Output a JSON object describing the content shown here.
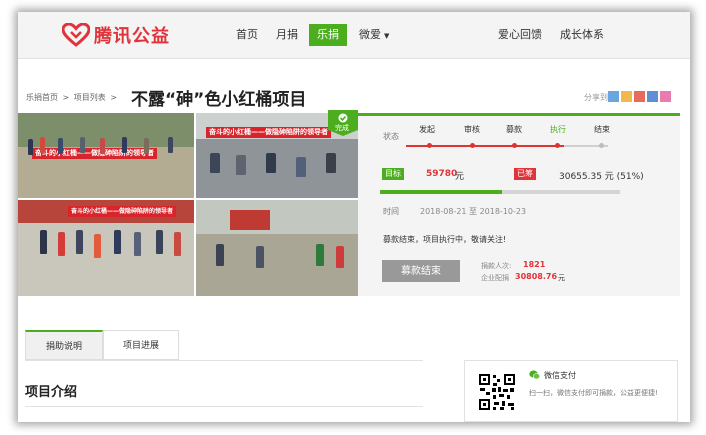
{
  "nav": {
    "logo_text": "腾讯公益",
    "items": [
      {
        "label": "首页"
      },
      {
        "label": "月捐"
      },
      {
        "label": "乐捐"
      },
      {
        "label": "微爱"
      },
      {
        "label": "爱心回馈"
      },
      {
        "label": "成长体系"
      }
    ],
    "active_color": "#4cae1e"
  },
  "breadcrumb": [
    "乐捐首页",
    ">",
    "项目列表",
    ">"
  ],
  "page_title": "不露“砷”色小红桶项目",
  "share_label": "分享到:",
  "photos": {
    "banners": [
      "奋斗的小红桶——做隐砷陷阱的领导者",
      "奋斗的小红桶——做隐砷陷阱的领导者",
      "奋斗的小红桶——做隐砷陷阱的领导者"
    ],
    "badge_label": "完成"
  },
  "status": {
    "label": "状态",
    "steps": [
      "发起",
      "审核",
      "募款",
      "执行",
      "结束"
    ],
    "current_step": "执行"
  },
  "funding": {
    "target_tag": "目标",
    "target_value": "59780",
    "unit": "元",
    "raised_tag": "已筹",
    "raised_value": "30655.35 元 (51%)",
    "progress_fraction": 0.51
  },
  "time": {
    "label": "时间",
    "range": "2018-08-21 至 2018-10-23"
  },
  "notice": "募款结束，项目执行中，敬请关注!",
  "ended_button": "募款结束",
  "stats": {
    "donors_label": "捐款人次:",
    "donors_value": "1821",
    "match_label": "企业配捐",
    "match_value": "30808.76",
    "match_unit": "元"
  },
  "tabs": [
    {
      "label": "捐助说明"
    },
    {
      "label": "项目进展"
    }
  ],
  "section_title": "项目介绍",
  "wechat": {
    "title": "微信支付",
    "desc": "扫一扫，微信支付即可捐款，公益更便捷!"
  },
  "colors": {
    "brand_red": "#e0343a",
    "green": "#4cae1e"
  }
}
